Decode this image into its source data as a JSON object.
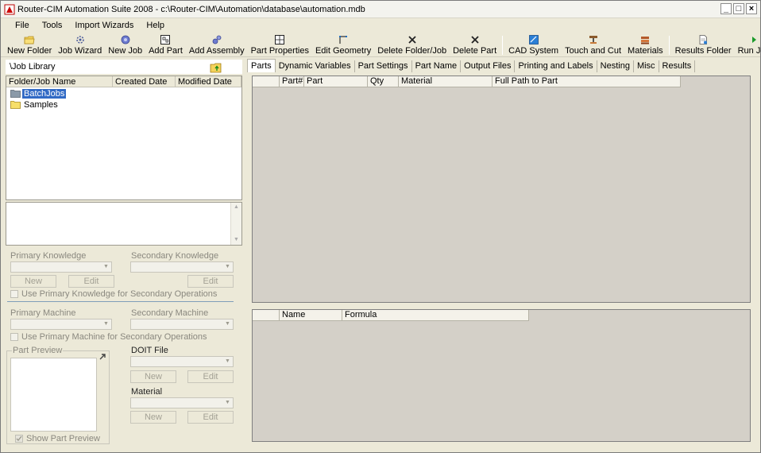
{
  "window": {
    "title": "Router-CIM Automation Suite 2008 - c:\\Router-CIM\\Automation\\database\\automation.mdb",
    "controls": [
      "_",
      "□",
      "×"
    ]
  },
  "menu": [
    "File",
    "Tools",
    "Import Wizards",
    "Help"
  ],
  "toolbar": [
    {
      "label": "New Folder",
      "icon": "folder-icon"
    },
    {
      "label": "Job Wizard",
      "icon": "wizard-icon"
    },
    {
      "label": "New Job",
      "icon": "gear-icon"
    },
    {
      "label": "Add Part",
      "icon": "part-icon"
    },
    {
      "label": "Add Assembly",
      "icon": "assembly-icon"
    },
    {
      "label": "Part Properties",
      "icon": "properties-icon"
    },
    {
      "label": "Edit Geometry",
      "icon": "geometry-icon"
    },
    {
      "label": "Delete Folder/Job",
      "icon": "x-icon"
    },
    {
      "label": "Delete Part",
      "icon": "x-icon"
    },
    {
      "label": "CAD System",
      "icon": "cad-icon"
    },
    {
      "label": "Touch and Cut",
      "icon": "touch-cut-icon"
    },
    {
      "label": "Materials",
      "icon": "materials-icon"
    },
    {
      "label": "Results Folder",
      "icon": "results-folder-icon"
    },
    {
      "label": "Run Job",
      "icon": "play-icon"
    }
  ],
  "library": {
    "path": "\\Job Library",
    "columns": [
      "Folder/Job Name",
      "Created Date",
      "Modified Date"
    ],
    "items": [
      {
        "name": "BatchJobs",
        "selected": true
      },
      {
        "name": "Samples",
        "selected": false
      }
    ]
  },
  "knowledge": {
    "primary_label": "Primary Knowledge",
    "secondary_label": "Secondary Knowledge",
    "new_label": "New",
    "edit_label": "Edit",
    "use_primary_label": "Use Primary Knowledge for Secondary Operations"
  },
  "machine": {
    "primary_label": "Primary Machine",
    "secondary_label": "Secondary Machine",
    "use_primary_label": "Use Primary Machine for Secondary Operations"
  },
  "preview": {
    "group_label": "Part Preview",
    "show_label": "Show Part Preview",
    "show_checked": true
  },
  "doit": {
    "label": "DOIT File",
    "new_label": "New",
    "edit_label": "Edit"
  },
  "material": {
    "label": "Material",
    "new_label": "New",
    "edit_label": "Edit"
  },
  "tabs": [
    "Parts",
    "Dynamic Variables",
    "Part Settings",
    "Part Name",
    "Output Files",
    "Printing and Labels",
    "Nesting",
    "Misc",
    "Results"
  ],
  "active_tab": "Parts",
  "parts_grid": {
    "columns": [
      "",
      "Part#",
      "Part",
      "Qty",
      "Material",
      "Full Path to Part"
    ]
  },
  "formula_grid": {
    "columns": [
      "",
      "Name",
      "Formula"
    ]
  }
}
